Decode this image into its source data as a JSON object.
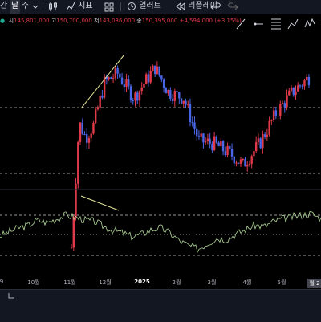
{
  "toolbar": {
    "items": [
      {
        "label": "간",
        "icon": ""
      },
      {
        "label": "날",
        "icon": ""
      },
      {
        "label": "주",
        "icon": ""
      },
      {
        "label": "",
        "icon": "chevron-down-icon"
      },
      {
        "label": "",
        "icon": "candles-icon"
      },
      {
        "label": "지표",
        "icon": "indicators-icon"
      },
      {
        "label": "",
        "icon": "grid-layout-icon"
      },
      {
        "label": "얼러트",
        "icon": "alert-clock-icon"
      },
      {
        "label": "리플레이",
        "icon": "replay-icon"
      },
      {
        "label": "",
        "icon": "undo-icon"
      },
      {
        "label": "",
        "icon": "redo-icon"
      }
    ]
  },
  "ohlc": {
    "open_label": "시",
    "open": "145,801,000",
    "high_label": "고",
    "high": "150,700,000",
    "low_label": "저",
    "low": "143,036,000",
    "close_label": "종",
    "close": "150,395,000",
    "change": "+4,594,000 (+3.15%)"
  },
  "drawing_tools": [
    "trend-line-icon",
    "horizontal-ray-icon",
    "fib-retracement-icon",
    "long-position-icon",
    "elliott-wave-icon",
    "forecast-icon"
  ],
  "colors": {
    "up": "#e0394a",
    "down": "#4a66e8",
    "osc": "#b4d99a",
    "dashed": "#9a9a9a",
    "trend": "#e6e69a",
    "toolbar_bg": "#131722"
  },
  "bottom_bar": {
    "scroll_icon": "arrow-down-left-icon"
  },
  "chart_data": [
    {
      "type": "candlestick",
      "title": "",
      "series": [
        {
          "name": "",
          "close_trend": [
            {
              "x": "2024-09-10",
              "y": null
            },
            {
              "x": "2024-11-05",
              "y": 101
            },
            {
              "x": "2024-11-08",
              "y": 118
            },
            {
              "x": "2024-11-12",
              "y": 142
            },
            {
              "x": "2024-11-18",
              "y": 137
            },
            {
              "x": "2024-11-25",
              "y": 141
            },
            {
              "x": "2024-12-05",
              "y": 155
            },
            {
              "x": "2024-12-17",
              "y": 158
            },
            {
              "x": "2025-01-01",
              "y": 150
            },
            {
              "x": "2025-01-20",
              "y": 160
            },
            {
              "x": "2025-02-01",
              "y": 152
            },
            {
              "x": "2025-02-15",
              "y": 150
            },
            {
              "x": "2025-03-01",
              "y": 136
            },
            {
              "x": "2025-03-15",
              "y": 135
            },
            {
              "x": "2025-04-01",
              "y": 131
            },
            {
              "x": "2025-04-10",
              "y": 128
            },
            {
              "x": "2025-04-25",
              "y": 135
            },
            {
              "x": "2025-05-10",
              "y": 145
            },
            {
              "x": "2025-05-25",
              "y": 152
            },
            {
              "x": "2025-06-10",
              "y": 157
            }
          ]
        }
      ],
      "x_tick_labels": [
        "9",
        "10월",
        "11월",
        "12월",
        "2025",
        "2월",
        "3월",
        "4월",
        "5월",
        "월 2"
      ],
      "horizontal_levels": [
        "dashed",
        "dashed"
      ],
      "annotations": [
        "trendline"
      ]
    },
    {
      "type": "line",
      "title": "",
      "series": [
        {
          "name": "",
          "values": [
            0.45,
            0.52,
            0.58,
            0.62,
            0.7,
            0.66,
            0.72,
            0.78,
            0.74,
            0.7,
            0.68,
            0.6,
            0.54,
            0.5,
            0.44,
            0.48,
            0.55,
            0.58,
            0.5,
            0.38,
            0.3,
            0.25,
            0.34,
            0.42,
            0.4,
            0.48,
            0.55,
            0.62,
            0.6,
            0.68,
            0.72,
            0.75,
            0.78,
            0.8,
            0.72
          ]
        }
      ],
      "levels": [
        "upper-dashed",
        "mid-dashed",
        "lower-dashed"
      ]
    }
  ]
}
